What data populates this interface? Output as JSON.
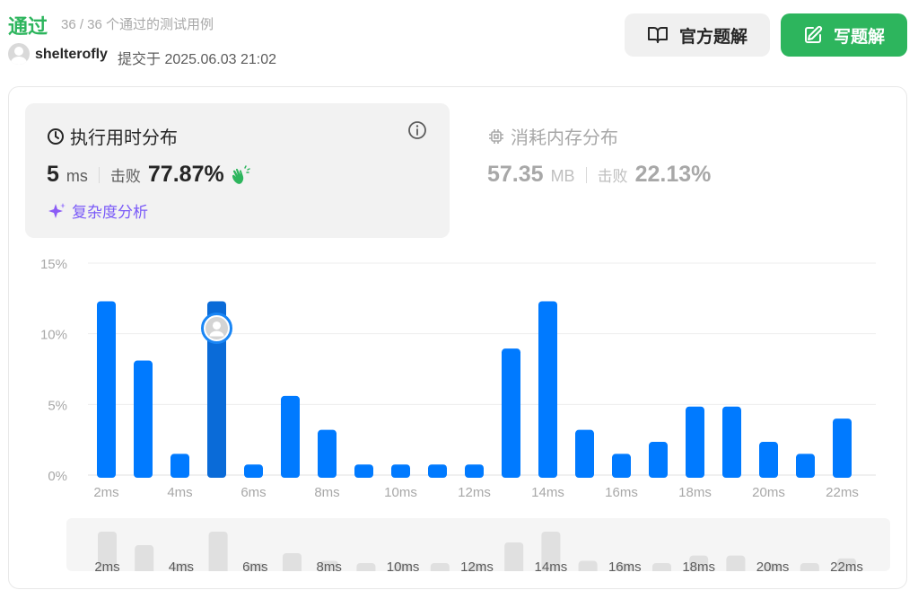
{
  "header": {
    "status": "通过",
    "cases": "36 / 36 个通过的测试用例",
    "username": "shelterofly",
    "submitted": "提交于 2025.06.03 21:02",
    "official_solution_label": "官方题解",
    "write_solution_label": "写题解"
  },
  "runtime": {
    "title": "执行用时分布",
    "value": "5",
    "unit": "ms",
    "beat_label": "击败",
    "beat_value": "77.87%",
    "complexity_label": "复杂度分析"
  },
  "memory": {
    "title": "消耗内存分布",
    "value": "57.35",
    "unit": "MB",
    "beat_label": "击败",
    "beat_value": "22.13%"
  },
  "colors": {
    "accent_green": "#2db55d",
    "bar_blue": "#007aff",
    "bar_highlight": "#0a6bd8",
    "mini_bar": "#e0e0e0"
  },
  "chart_data": {
    "type": "bar",
    "categories": [
      "2ms",
      "3ms",
      "4ms",
      "5ms",
      "6ms",
      "7ms",
      "8ms",
      "9ms",
      "10ms",
      "11ms",
      "12ms",
      "13ms",
      "14ms",
      "15ms",
      "16ms",
      "17ms",
      "18ms",
      "19ms",
      "20ms",
      "21ms",
      "22ms"
    ],
    "tick_labels": [
      "2ms",
      "4ms",
      "6ms",
      "8ms",
      "10ms",
      "12ms",
      "14ms",
      "16ms",
      "18ms",
      "20ms",
      "22ms"
    ],
    "values": [
      12.3,
      8.1,
      1.5,
      12.3,
      0.75,
      5.6,
      3.2,
      0.75,
      0.75,
      0.75,
      0.75,
      8.95,
      12.3,
      3.2,
      1.5,
      2.35,
      4.85,
      4.85,
      2.35,
      1.5,
      4.0
    ],
    "highlight": "5ms",
    "y_ticks": [
      "0%",
      "5%",
      "10%",
      "15%"
    ],
    "ylim": [
      0,
      15
    ],
    "grid": true
  }
}
